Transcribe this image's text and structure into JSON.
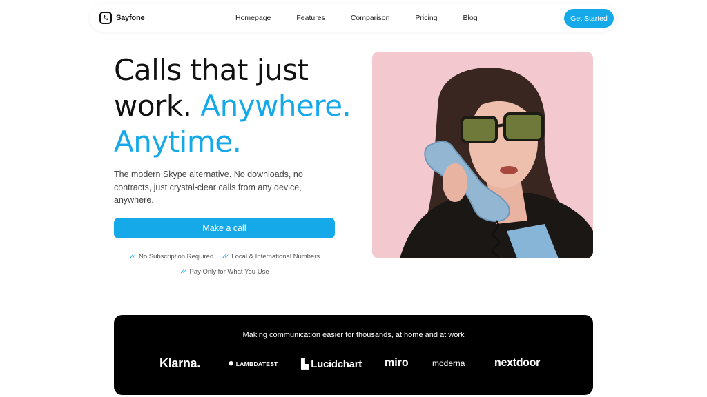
{
  "brand": {
    "name": "Sayfone",
    "accent_color": "#16a9ea"
  },
  "nav": {
    "links": [
      "Homepage",
      "Features",
      "Comparison",
      "Pricing",
      "Blog"
    ],
    "cta_label": "Get Started"
  },
  "hero": {
    "headline_line1": "Calls that just",
    "headline_line2a": "work.",
    "headline_line2b": "Anywhere.",
    "headline_line3": "Anytime.",
    "subtext": "The modern Skype alternative. No downloads, no contracts, just crystal-clear calls from any device, anywhere.",
    "cta_label": "Make a call",
    "perks": [
      "No Subscription Required",
      "Local & International Numbers",
      "Pay Only for What You Use"
    ]
  },
  "logos": {
    "title": "Making communication easier for thousands, at home and at work",
    "brands": [
      "Klarna.",
      "LAMBDATEST",
      "Lucidchart",
      "miro",
      "moderna",
      "nextdoor"
    ]
  }
}
